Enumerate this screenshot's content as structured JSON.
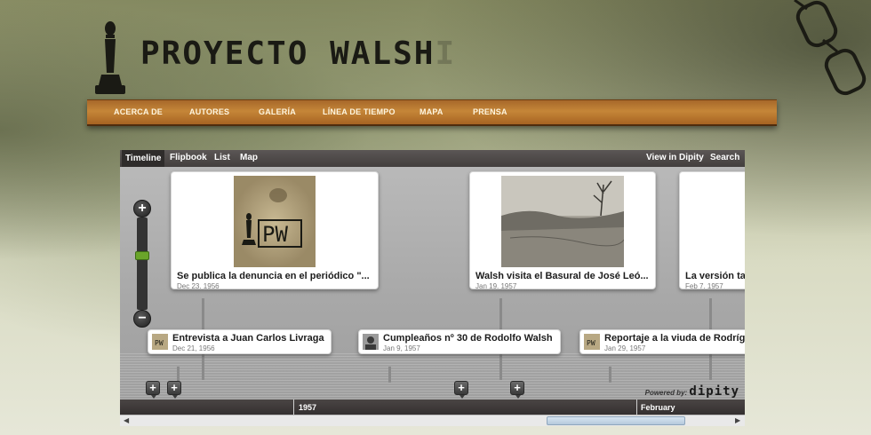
{
  "site": {
    "title_main": "PROYECTO WALSH",
    "title_ghost": "I",
    "nav": [
      {
        "label": "ACERCA DE"
      },
      {
        "label": "AUTORES"
      },
      {
        "label": "GALERÍA"
      },
      {
        "label": "LÍNEA DE TIEMPO"
      },
      {
        "label": "MAPA"
      },
      {
        "label": "PRENSA"
      }
    ]
  },
  "timeline": {
    "tabs": [
      {
        "label": "Timeline",
        "active": true
      },
      {
        "label": "Flipbook"
      },
      {
        "label": "List"
      },
      {
        "label": "Map"
      }
    ],
    "right_links": [
      {
        "label": "View in Dipity"
      },
      {
        "label": "Search"
      }
    ],
    "cards": [
      {
        "title": "Se publica la denuncia en el periódico \"...",
        "date": "Dec 23, 1956",
        "image": "pw-logo-image"
      },
      {
        "title": "Walsh visita el Basural de José Leó...",
        "date": "Jan 19, 1957",
        "image": "wasteland-photo"
      },
      {
        "title": "La versión ta",
        "date": "Feb 7, 1957",
        "image": "none"
      }
    ],
    "pills": [
      {
        "title": "Entrevista a Juan Carlos Livraga",
        "date": "Dec 21, 1956"
      },
      {
        "title": "Cumpleaños nº 30 de Rodolfo Walsh",
        "date": "Jan 9, 1957"
      },
      {
        "title": "Reportaje a la viuda de Rodríg",
        "date": "Jan 29, 1957"
      }
    ],
    "powered_by": "Powered by:",
    "brand": "dipity",
    "scale_labels": [
      "1957",
      "February"
    ],
    "zoom": {
      "plus": "+",
      "minus": "−",
      "level": 0.4
    },
    "add_label": "+"
  },
  "colors": {
    "nav_bar": "#b87632",
    "zoom_thumb": "#6aa52a",
    "widget_bar": "#433f3e"
  }
}
